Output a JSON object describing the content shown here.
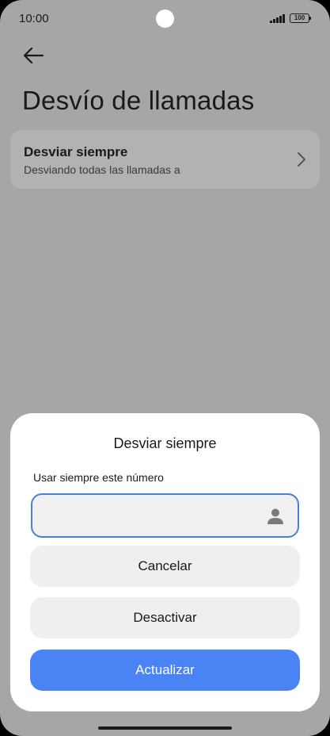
{
  "status_bar": {
    "time": "10:00",
    "battery": "100",
    "icons": [
      "signal-icon",
      "battery-icon"
    ]
  },
  "header": {
    "back_icon": "arrow-left-icon",
    "title": "Desvío de llamadas"
  },
  "setting": {
    "title": "Desviar siempre",
    "subtitle": "Desviando todas las llamadas a",
    "icon": "chevron-right-icon"
  },
  "dialog": {
    "title": "Desviar siempre",
    "label": "Usar siempre este número",
    "input": {
      "value": "",
      "placeholder": ""
    },
    "contact_icon": "person-icon",
    "cancel_label": "Cancelar",
    "deactivate_label": "Desactivar",
    "update_label": "Actualizar"
  },
  "colors": {
    "overlay_background": "#a6a6a6",
    "primary_button": "#4a84f4",
    "input_border": "#4a7fd8"
  }
}
